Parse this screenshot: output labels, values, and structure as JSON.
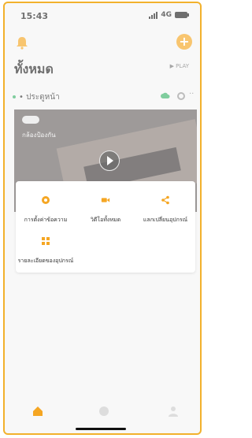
{
  "status": {
    "time": "15:43",
    "network": "4G"
  },
  "header": {
    "title": "ทั้งหมด",
    "play_label": "▶ PLAY"
  },
  "section": {
    "label": "• ประตูหน้า"
  },
  "camera": {
    "name": "กล้องป้องกัน"
  },
  "menu": {
    "items": [
      {
        "label": "การตั้งค่าข้อความ",
        "icon": "gear-icon"
      },
      {
        "label": "วิดีโอทั้งหมด",
        "icon": "video-camera-icon"
      },
      {
        "label": "แลกเปลี่ยนอุปกรณ์",
        "icon": "share-icon"
      },
      {
        "label": "รายละเอียดของอุปกรณ์",
        "icon": "grid-icon"
      }
    ]
  },
  "colors": {
    "accent": "#f5a623",
    "frame": "#f2b12c",
    "online": "#3db36b"
  }
}
